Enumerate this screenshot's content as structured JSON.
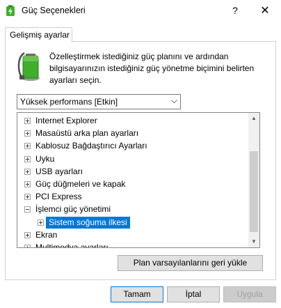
{
  "window": {
    "title": "Güç Seçenekleri",
    "help_glyph": "?",
    "close_glyph": "✕"
  },
  "tab": {
    "label": "Gelişmiş ayarlar"
  },
  "description": "Özelleştirmek istediğiniz güç planını ve ardından bilgisayarınızın istediğiniz güç yönetme biçimini belirten ayarları seçin.",
  "plan_select": {
    "value": "Yüksek performans [Etkin]",
    "chevron": "⌵"
  },
  "tree": {
    "items": [
      {
        "label": "Internet Explorer",
        "expander": "plus",
        "level": 0
      },
      {
        "label": "Masaüstü arka plan ayarları",
        "expander": "plus",
        "level": 0
      },
      {
        "label": "Kablosuz Bağdaştırıcı Ayarları",
        "expander": "plus",
        "level": 0
      },
      {
        "label": "Uyku",
        "expander": "plus",
        "level": 0
      },
      {
        "label": "USB ayarları",
        "expander": "plus",
        "level": 0
      },
      {
        "label": "Güç düğmeleri ve kapak",
        "expander": "plus",
        "level": 0
      },
      {
        "label": "PCI Express",
        "expander": "plus",
        "level": 0
      },
      {
        "label": "İşlemci güç yönetimi",
        "expander": "minus",
        "level": 0
      },
      {
        "label": "Sistem soğuma ilkesi",
        "expander": "plus",
        "level": 1,
        "selected": true
      },
      {
        "label": "Ekran",
        "expander": "plus",
        "level": 0
      },
      {
        "label": "Multimedya ayarları",
        "expander": "plus",
        "level": 0
      }
    ],
    "scroll_up_glyph": "▲",
    "scroll_down_glyph": "▼"
  },
  "buttons": {
    "restore_defaults": "Plan varsayılanlarını geri yükle",
    "ok": "Tamam",
    "cancel": "İptal",
    "apply": "Uygula"
  },
  "colors": {
    "selection": "#0078d7",
    "battery_green": "#3fae2a"
  }
}
